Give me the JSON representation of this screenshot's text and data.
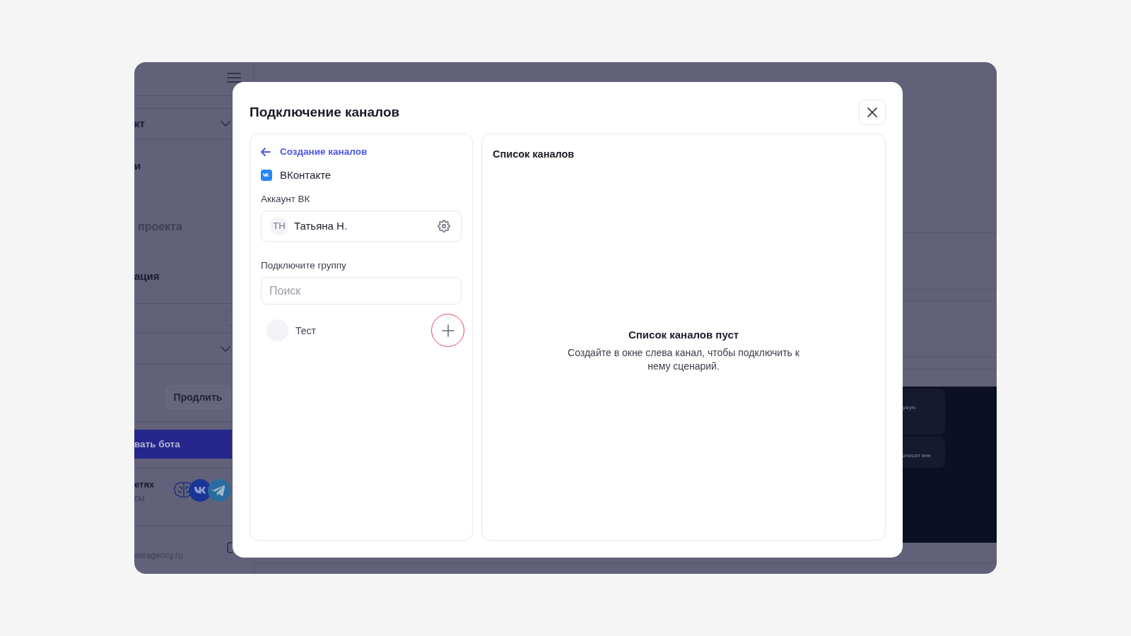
{
  "backdrop": {
    "sidebar": {
      "nav_items": [
        {
          "kind": "dropdown",
          "label": "кт"
        },
        {
          "kind": "link",
          "label": "и"
        },
        {
          "kind": "muted",
          "label": "проекта"
        },
        {
          "kind": "link",
          "label": "ация"
        },
        {
          "kind": "field"
        },
        {
          "kind": "dropdown"
        }
      ],
      "renew_button": "Продлить",
      "bot_button": "вать бота",
      "networks": {
        "title": "етях",
        "subtitle": "сы"
      },
      "footer": {
        "site": "ateagency.ru"
      }
    },
    "chat": {
      "messages": [
        {
          "text": "ужую"
        },
        {
          "text": "аписал мне"
        }
      ]
    }
  },
  "modal": {
    "title": "Подключение каналов",
    "back_link": "Создание каналов",
    "platform": "ВКонтакте",
    "account": {
      "label": "Аккаунт ВК",
      "initials": "ТН",
      "name": "Татьяна Н."
    },
    "group_section": {
      "label": "Подключите группу",
      "search": {
        "placeholder": "Поиск"
      },
      "groups": [
        {
          "name": "Тест",
          "highlighted": true
        }
      ]
    },
    "channel_list": {
      "title": "Список каналов",
      "empty_title": "Список каналов пуст",
      "empty_text": "Создайте в окне слева канал, чтобы подключить к нему сценарий."
    }
  }
}
